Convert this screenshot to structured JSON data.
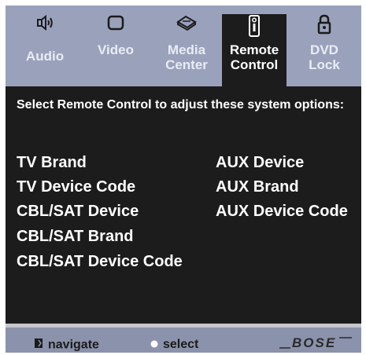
{
  "tabs": [
    {
      "icon": "speaker-icon",
      "label": "Audio"
    },
    {
      "icon": "tv-screen-icon",
      "label": "Video"
    },
    {
      "icon": "media-center-icon",
      "label": "Media Center"
    },
    {
      "icon": "remote-control-icon",
      "label": "Remote Control",
      "active": true
    },
    {
      "icon": "padlock-icon",
      "label": "DVD Lock"
    }
  ],
  "content": {
    "intro": "Select Remote Control to adjust these system options:",
    "left_options": [
      "TV Brand",
      "TV Device Code",
      "CBL/SAT Device",
      "CBL/SAT Brand",
      "CBL/SAT Device Code"
    ],
    "right_options": [
      "AUX Device",
      "AUX Brand",
      "AUX Device Code"
    ]
  },
  "footer": {
    "navigate_label": "navigate",
    "select_label": "select",
    "brand": "BOSE"
  },
  "colors": {
    "tab_bar": "#9aa2bb",
    "screen_bg": "#1c1c1c",
    "footer_bar": "#8b92ab",
    "text": "#ffffff"
  }
}
